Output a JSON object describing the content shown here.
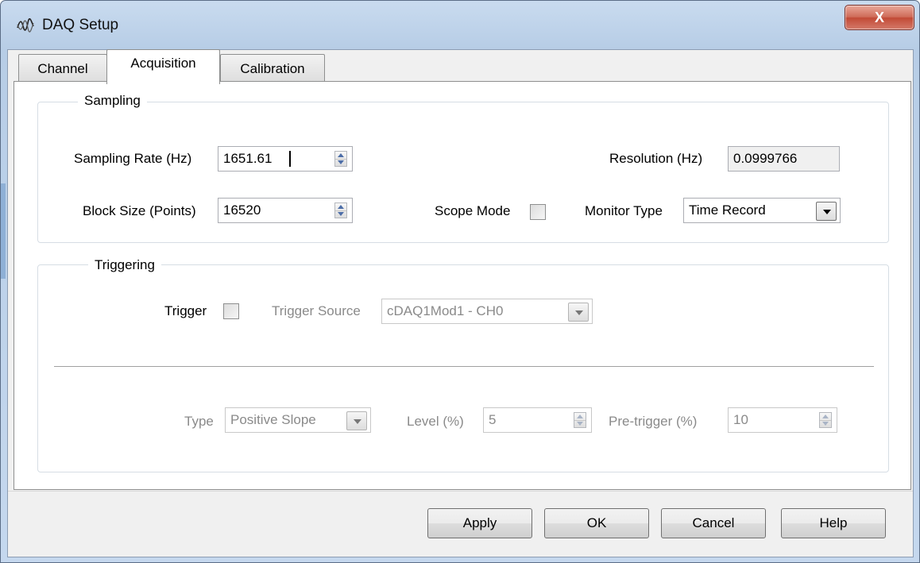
{
  "window": {
    "title": "DAQ Setup",
    "close_glyph": "X",
    "icon": "waveform-app-icon"
  },
  "tabs": [
    {
      "label": "Channel",
      "active": false
    },
    {
      "label": "Acquisition",
      "active": true
    },
    {
      "label": "Calibration",
      "active": false
    }
  ],
  "sampling": {
    "group_title": "Sampling",
    "sampling_rate_label": "Sampling Rate (Hz)",
    "sampling_rate_value": "1651.61",
    "resolution_label": "Resolution (Hz)",
    "resolution_value": "0.0999766",
    "block_size_label": "Block Size (Points)",
    "block_size_value": "16520",
    "scope_mode_label": "Scope Mode",
    "scope_mode_checked": false,
    "monitor_type_label": "Monitor Type",
    "monitor_type_value": "Time Record"
  },
  "triggering": {
    "group_title": "Triggering",
    "trigger_label": "Trigger",
    "trigger_checked": false,
    "trigger_source_label": "Trigger Source",
    "trigger_source_value": "cDAQ1Mod1 - CH0",
    "type_label": "Type",
    "type_value": "Positive Slope",
    "level_label": "Level (%)",
    "level_value": "5",
    "pretrigger_label": "Pre-trigger (%)",
    "pretrigger_value": "10"
  },
  "buttons": {
    "apply": "Apply",
    "ok": "OK",
    "cancel": "Cancel",
    "help": "Help"
  },
  "colors": {
    "titlebar": "#c9dbef",
    "close_button": "#c24a36",
    "dialog_bg": "#f0f0f0",
    "disabled_text": "#8a8a8a"
  }
}
